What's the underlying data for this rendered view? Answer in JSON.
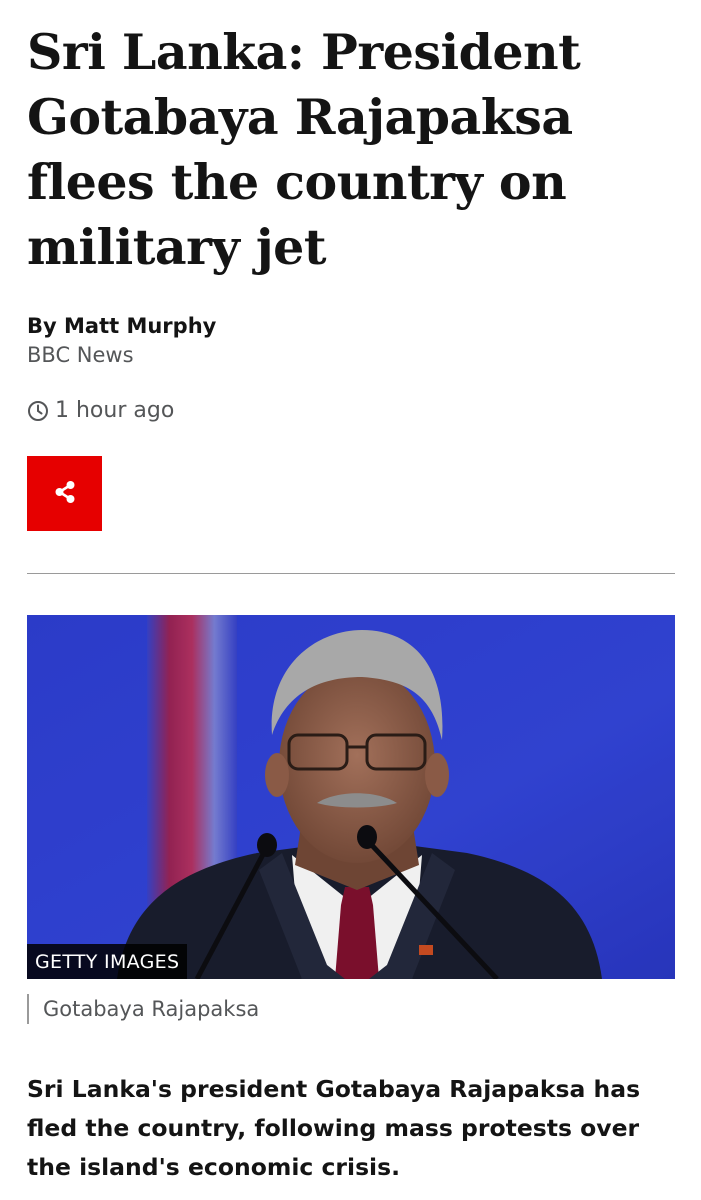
{
  "article": {
    "headline": "Sri Lanka: President Gotabaya Rajapaksa flees the country on military jet",
    "byline": {
      "author": "By Matt Murphy",
      "organization": "BBC News"
    },
    "timestamp": "1 hour ago",
    "share": {
      "icon": "share-icon",
      "color": "#e60000"
    },
    "image": {
      "credit": "GETTY IMAGES",
      "caption": "Gotabaya Rajapaksa"
    },
    "lede": "Sri Lanka's president Gotabaya Rajapaksa has fled the country, following mass protests over the island's economic crisis."
  }
}
